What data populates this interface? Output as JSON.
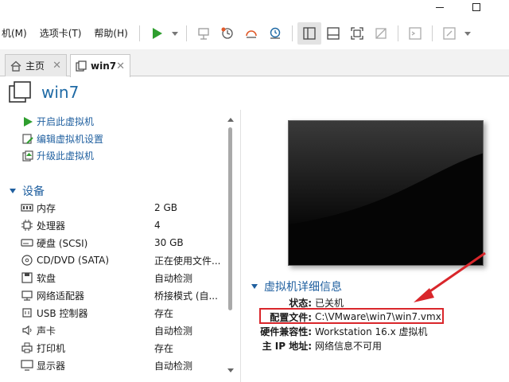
{
  "window_controls": {
    "minimize": "—",
    "maximize": "□"
  },
  "menu": {
    "vm": "机(M)",
    "tabs": "选项卡(T)",
    "help": "帮助(H)"
  },
  "tabs": [
    {
      "label": "主页"
    },
    {
      "label": "win7"
    }
  ],
  "vm": {
    "title": "win7"
  },
  "actions": [
    {
      "label": "开启此虚拟机",
      "icon": "play-icon"
    },
    {
      "label": "编辑虚拟机设置",
      "icon": "edit-settings-icon"
    },
    {
      "label": "升级此虚拟机",
      "icon": "upgrade-icon"
    }
  ],
  "devices_section": {
    "title": "设备"
  },
  "devices": [
    {
      "name": "内存",
      "value": "2 GB",
      "icon": "memory-icon"
    },
    {
      "name": "处理器",
      "value": "4",
      "icon": "cpu-icon"
    },
    {
      "name": "硬盘 (SCSI)",
      "value": "30 GB",
      "icon": "hard-disk-icon"
    },
    {
      "name": "CD/DVD (SATA)",
      "value": "正在使用文件...",
      "icon": "cd-dvd-icon"
    },
    {
      "name": "软盘",
      "value": "自动检测",
      "icon": "floppy-icon"
    },
    {
      "name": "网络适配器",
      "value": "桥接模式 (自...",
      "icon": "network-adapter-icon"
    },
    {
      "name": "USB 控制器",
      "value": "存在",
      "icon": "usb-icon"
    },
    {
      "name": "声卡",
      "value": "自动检测",
      "icon": "sound-card-icon"
    },
    {
      "name": "打印机",
      "value": "存在",
      "icon": "printer-icon"
    },
    {
      "name": "显示器",
      "value": "自动检测",
      "icon": "display-icon"
    }
  ],
  "details_section": {
    "title": "虚拟机详细信息"
  },
  "details": [
    {
      "key": "状态:",
      "value": "已关机"
    },
    {
      "key": "配置文件:",
      "value": "C:\\VMware\\win7\\win7.vmx"
    },
    {
      "key": "硬件兼容性:",
      "value": "Workstation 16.x 虚拟机"
    },
    {
      "key": "主 IP 地址:",
      "value": "网络信息不可用"
    }
  ],
  "colors": {
    "accent": "#1f6aa5",
    "play_green": "#2e9e2e",
    "highlight_red": "#d9262b"
  }
}
